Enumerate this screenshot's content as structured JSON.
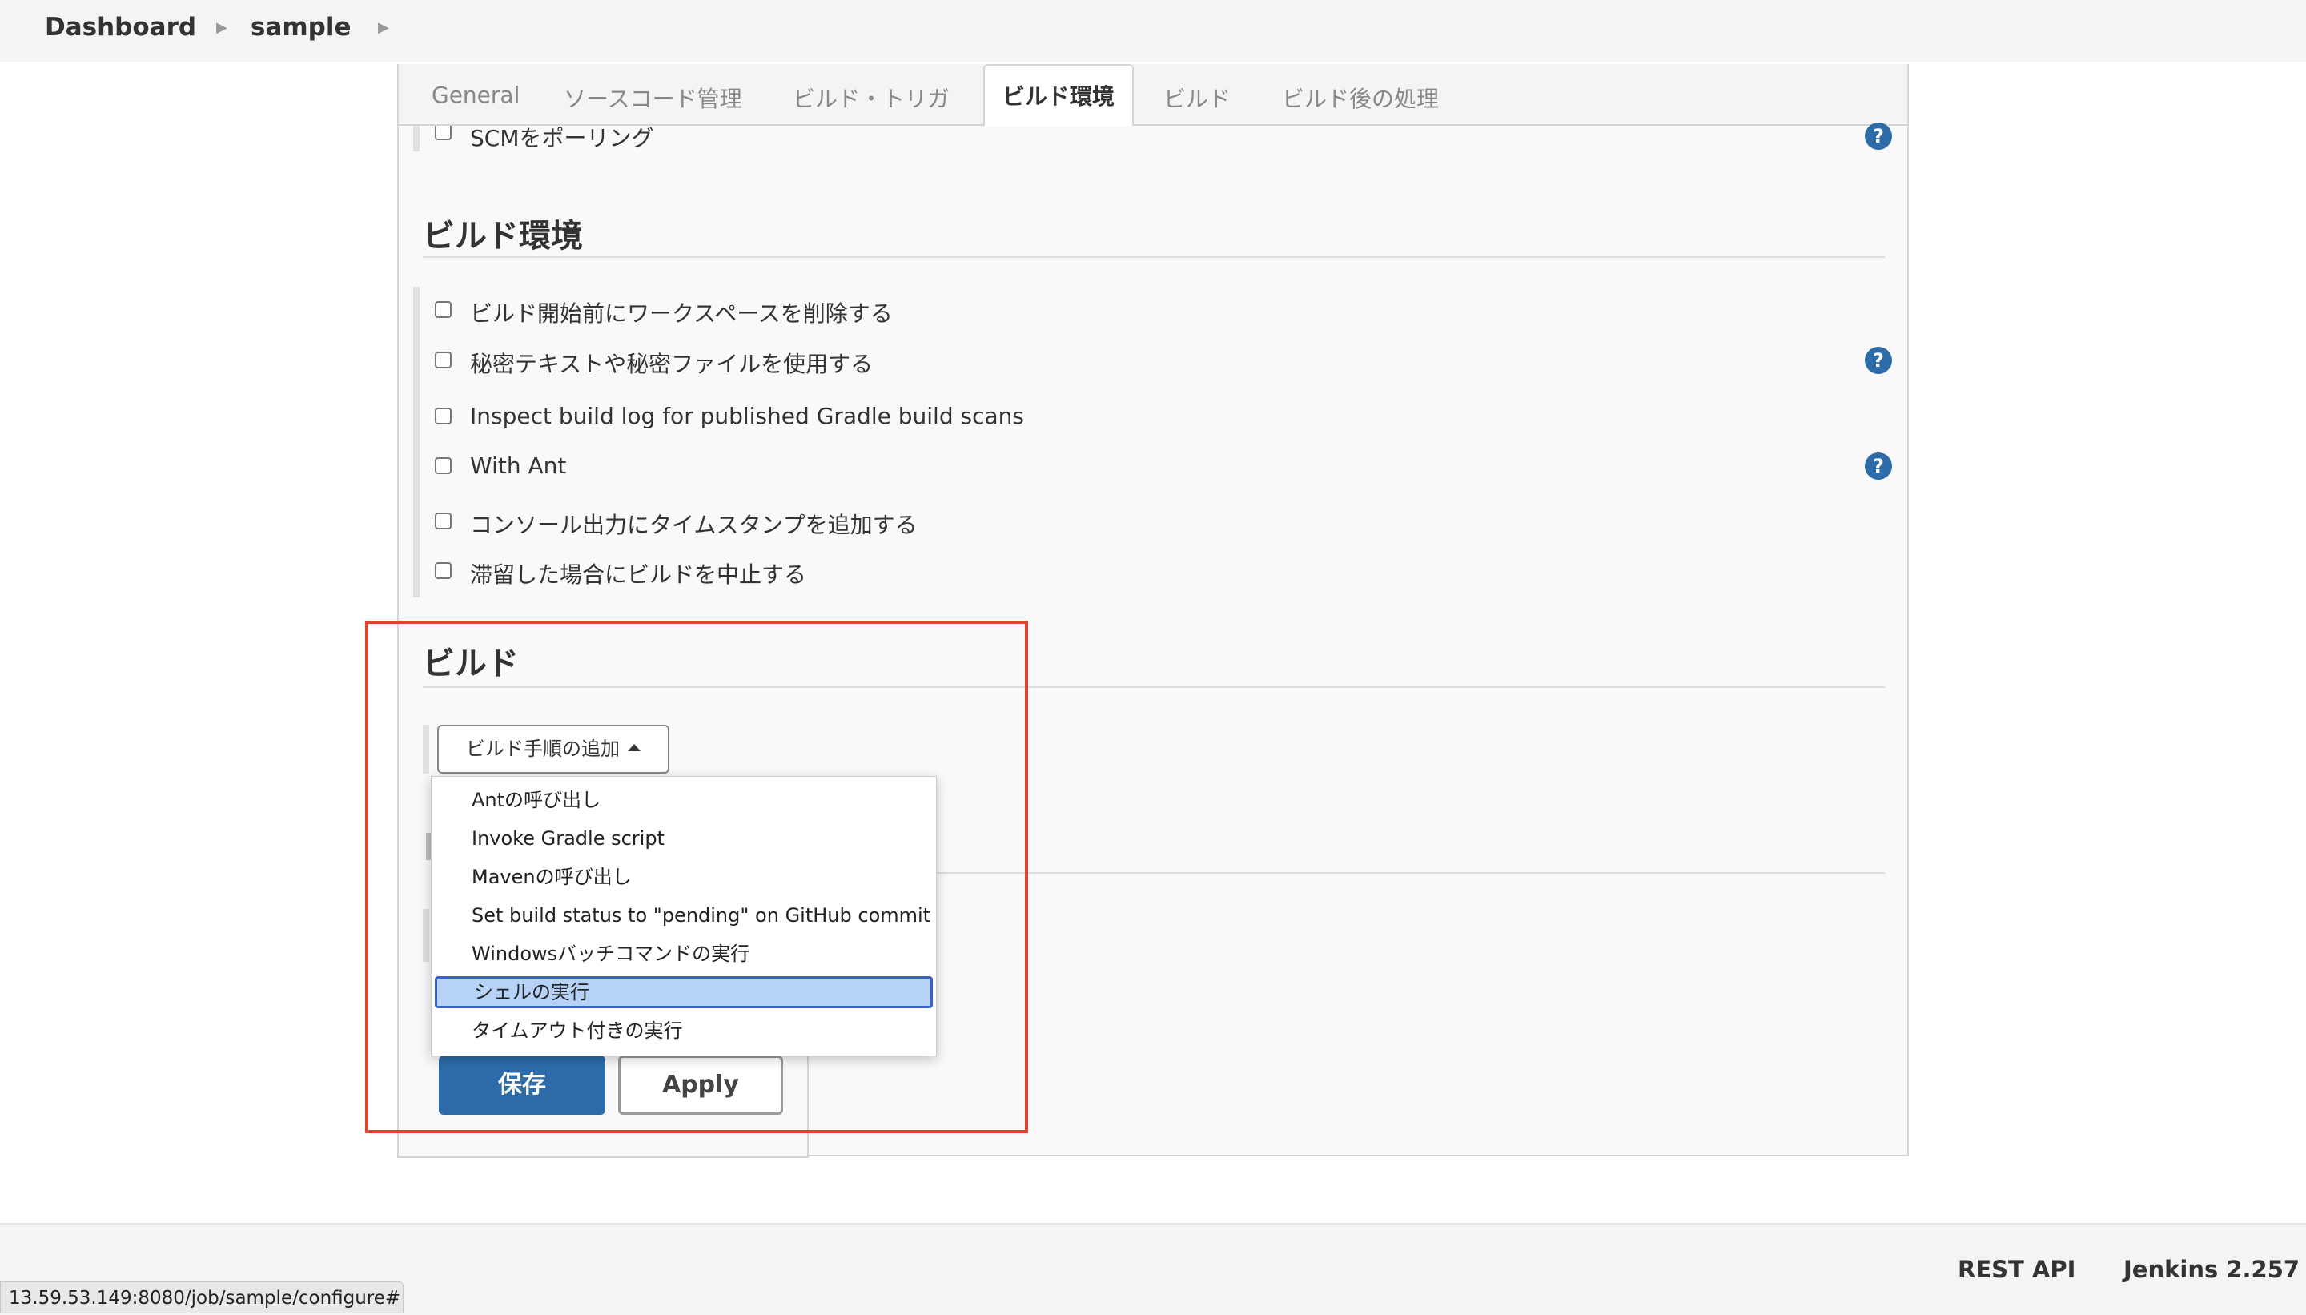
{
  "breadcrumb": {
    "items": [
      "Dashboard",
      "sample"
    ]
  },
  "tabs": [
    {
      "label": "General",
      "active": false
    },
    {
      "label": "ソースコード管理",
      "active": false
    },
    {
      "label": "ビルド・トリガ",
      "active": false
    },
    {
      "label": "ビルド環境",
      "active": true
    },
    {
      "label": "ビルド",
      "active": false
    },
    {
      "label": "ビルド後の処理",
      "active": false
    }
  ],
  "triggers": {
    "scm_polling": "SCMをポーリング"
  },
  "build_env": {
    "title": "ビルド環境",
    "options": [
      {
        "label": "ビルド開始前にワークスペースを削除する",
        "checked": false,
        "help": false
      },
      {
        "label": "秘密テキストや秘密ファイルを使用する",
        "checked": false,
        "help": true
      },
      {
        "label": "Inspect build log for published Gradle build scans",
        "checked": false,
        "help": false
      },
      {
        "label": "With Ant",
        "checked": false,
        "help": true
      },
      {
        "label": "コンソール出力にタイムスタンプを追加する",
        "checked": false,
        "help": false
      },
      {
        "label": "滞留した場合にビルドを中止する",
        "checked": false,
        "help": false
      }
    ]
  },
  "build": {
    "title": "ビルド",
    "add_step_label": "ビルド手順の追加",
    "menu": [
      {
        "label": "Antの呼び出し",
        "selected": false
      },
      {
        "label": "Invoke Gradle script",
        "selected": false
      },
      {
        "label": "Mavenの呼び出し",
        "selected": false
      },
      {
        "label": "Set build status to \"pending\" on GitHub commit",
        "selected": false
      },
      {
        "label": "Windowsバッチコマンドの実行",
        "selected": false
      },
      {
        "label": "シェルの実行",
        "selected": true
      },
      {
        "label": "タイムアウト付きの実行",
        "selected": false
      }
    ]
  },
  "actions": {
    "save": "保存",
    "apply": "Apply"
  },
  "footer": {
    "rest_api": "REST API",
    "version": "Jenkins 2.257"
  },
  "status_url": "13.59.53.149:8080/job/sample/configure#",
  "help_glyph": "?",
  "colors": {
    "primary": "#2d6ca8",
    "highlight": "#e0432b",
    "selected_bg": "#b7d2f7"
  }
}
